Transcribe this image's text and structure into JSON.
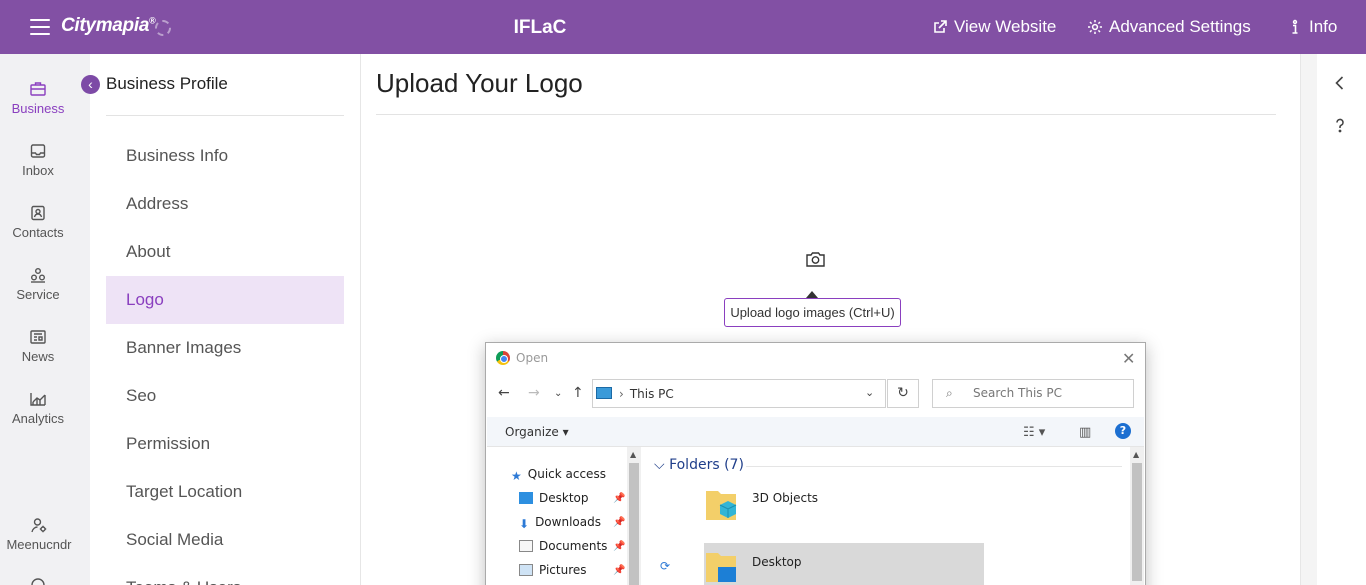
{
  "app": {
    "brand": "Citymapia",
    "brand_mark": "®",
    "title": "IFLaC",
    "links": {
      "view_website": "View Website",
      "advanced_settings": "Advanced Settings",
      "info": "Info"
    }
  },
  "rail": {
    "items": [
      {
        "label": "Business",
        "icon": "briefcase-icon",
        "active": true
      },
      {
        "label": "Inbox",
        "icon": "inbox-icon"
      },
      {
        "label": "Contacts",
        "icon": "contacts-icon"
      },
      {
        "label": "Service",
        "icon": "service-icon"
      },
      {
        "label": "News",
        "icon": "news-icon"
      },
      {
        "label": "Analytics",
        "icon": "analytics-icon"
      }
    ],
    "user": "Meenucndr"
  },
  "subnav": {
    "title": "Business Profile",
    "items": [
      {
        "label": "Business Info"
      },
      {
        "label": "Address"
      },
      {
        "label": "About"
      },
      {
        "label": "Logo",
        "active": true
      },
      {
        "label": "Banner Images"
      },
      {
        "label": "Seo"
      },
      {
        "label": "Permission"
      },
      {
        "label": "Target Location"
      },
      {
        "label": "Social Media"
      },
      {
        "label": "Teams & Users"
      }
    ]
  },
  "main": {
    "title": "Upload Your Logo",
    "upload_tooltip": "Upload logo images (Ctrl+U)"
  },
  "dialog": {
    "title": "Open",
    "address_crumb": "This PC",
    "search_placeholder": "Search This PC",
    "organize": "Organize",
    "tree": [
      {
        "label": "Quick access",
        "icon": "star-icon"
      },
      {
        "label": "Desktop",
        "icon": "desktop-icon",
        "pinned": true
      },
      {
        "label": "Downloads",
        "icon": "download-icon",
        "pinned": true
      },
      {
        "label": "Documents",
        "icon": "document-icon",
        "pinned": true
      },
      {
        "label": "Pictures",
        "icon": "pictures-icon",
        "pinned": true
      }
    ],
    "group": "Folders (7)",
    "folders": [
      {
        "label": "3D Objects",
        "icon": "3d-objects-icon"
      },
      {
        "label": "Desktop",
        "icon": "desktop-folder-icon",
        "selected": true
      }
    ]
  }
}
